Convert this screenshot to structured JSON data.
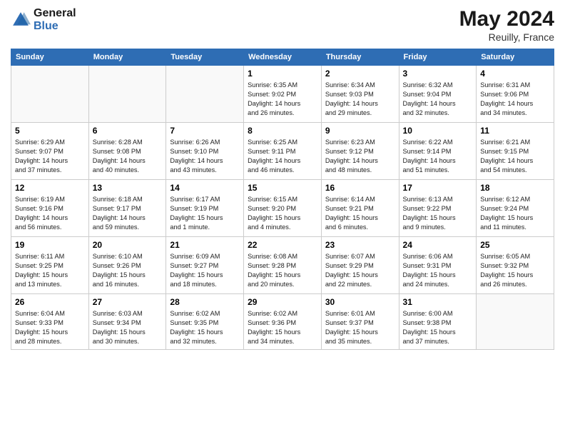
{
  "header": {
    "logo_line1": "General",
    "logo_line2": "Blue",
    "month_year": "May 2024",
    "location": "Reuilly, France"
  },
  "weekdays": [
    "Sunday",
    "Monday",
    "Tuesday",
    "Wednesday",
    "Thursday",
    "Friday",
    "Saturday"
  ],
  "weeks": [
    [
      {
        "day": "",
        "info": ""
      },
      {
        "day": "",
        "info": ""
      },
      {
        "day": "",
        "info": ""
      },
      {
        "day": "1",
        "info": "Sunrise: 6:35 AM\nSunset: 9:02 PM\nDaylight: 14 hours\nand 26 minutes."
      },
      {
        "day": "2",
        "info": "Sunrise: 6:34 AM\nSunset: 9:03 PM\nDaylight: 14 hours\nand 29 minutes."
      },
      {
        "day": "3",
        "info": "Sunrise: 6:32 AM\nSunset: 9:04 PM\nDaylight: 14 hours\nand 32 minutes."
      },
      {
        "day": "4",
        "info": "Sunrise: 6:31 AM\nSunset: 9:06 PM\nDaylight: 14 hours\nand 34 minutes."
      }
    ],
    [
      {
        "day": "5",
        "info": "Sunrise: 6:29 AM\nSunset: 9:07 PM\nDaylight: 14 hours\nand 37 minutes."
      },
      {
        "day": "6",
        "info": "Sunrise: 6:28 AM\nSunset: 9:08 PM\nDaylight: 14 hours\nand 40 minutes."
      },
      {
        "day": "7",
        "info": "Sunrise: 6:26 AM\nSunset: 9:10 PM\nDaylight: 14 hours\nand 43 minutes."
      },
      {
        "day": "8",
        "info": "Sunrise: 6:25 AM\nSunset: 9:11 PM\nDaylight: 14 hours\nand 46 minutes."
      },
      {
        "day": "9",
        "info": "Sunrise: 6:23 AM\nSunset: 9:12 PM\nDaylight: 14 hours\nand 48 minutes."
      },
      {
        "day": "10",
        "info": "Sunrise: 6:22 AM\nSunset: 9:14 PM\nDaylight: 14 hours\nand 51 minutes."
      },
      {
        "day": "11",
        "info": "Sunrise: 6:21 AM\nSunset: 9:15 PM\nDaylight: 14 hours\nand 54 minutes."
      }
    ],
    [
      {
        "day": "12",
        "info": "Sunrise: 6:19 AM\nSunset: 9:16 PM\nDaylight: 14 hours\nand 56 minutes."
      },
      {
        "day": "13",
        "info": "Sunrise: 6:18 AM\nSunset: 9:17 PM\nDaylight: 14 hours\nand 59 minutes."
      },
      {
        "day": "14",
        "info": "Sunrise: 6:17 AM\nSunset: 9:19 PM\nDaylight: 15 hours\nand 1 minute."
      },
      {
        "day": "15",
        "info": "Sunrise: 6:15 AM\nSunset: 9:20 PM\nDaylight: 15 hours\nand 4 minutes."
      },
      {
        "day": "16",
        "info": "Sunrise: 6:14 AM\nSunset: 9:21 PM\nDaylight: 15 hours\nand 6 minutes."
      },
      {
        "day": "17",
        "info": "Sunrise: 6:13 AM\nSunset: 9:22 PM\nDaylight: 15 hours\nand 9 minutes."
      },
      {
        "day": "18",
        "info": "Sunrise: 6:12 AM\nSunset: 9:24 PM\nDaylight: 15 hours\nand 11 minutes."
      }
    ],
    [
      {
        "day": "19",
        "info": "Sunrise: 6:11 AM\nSunset: 9:25 PM\nDaylight: 15 hours\nand 13 minutes."
      },
      {
        "day": "20",
        "info": "Sunrise: 6:10 AM\nSunset: 9:26 PM\nDaylight: 15 hours\nand 16 minutes."
      },
      {
        "day": "21",
        "info": "Sunrise: 6:09 AM\nSunset: 9:27 PM\nDaylight: 15 hours\nand 18 minutes."
      },
      {
        "day": "22",
        "info": "Sunrise: 6:08 AM\nSunset: 9:28 PM\nDaylight: 15 hours\nand 20 minutes."
      },
      {
        "day": "23",
        "info": "Sunrise: 6:07 AM\nSunset: 9:29 PM\nDaylight: 15 hours\nand 22 minutes."
      },
      {
        "day": "24",
        "info": "Sunrise: 6:06 AM\nSunset: 9:31 PM\nDaylight: 15 hours\nand 24 minutes."
      },
      {
        "day": "25",
        "info": "Sunrise: 6:05 AM\nSunset: 9:32 PM\nDaylight: 15 hours\nand 26 minutes."
      }
    ],
    [
      {
        "day": "26",
        "info": "Sunrise: 6:04 AM\nSunset: 9:33 PM\nDaylight: 15 hours\nand 28 minutes."
      },
      {
        "day": "27",
        "info": "Sunrise: 6:03 AM\nSunset: 9:34 PM\nDaylight: 15 hours\nand 30 minutes."
      },
      {
        "day": "28",
        "info": "Sunrise: 6:02 AM\nSunset: 9:35 PM\nDaylight: 15 hours\nand 32 minutes."
      },
      {
        "day": "29",
        "info": "Sunrise: 6:02 AM\nSunset: 9:36 PM\nDaylight: 15 hours\nand 34 minutes."
      },
      {
        "day": "30",
        "info": "Sunrise: 6:01 AM\nSunset: 9:37 PM\nDaylight: 15 hours\nand 35 minutes."
      },
      {
        "day": "31",
        "info": "Sunrise: 6:00 AM\nSunset: 9:38 PM\nDaylight: 15 hours\nand 37 minutes."
      },
      {
        "day": "",
        "info": ""
      }
    ]
  ]
}
